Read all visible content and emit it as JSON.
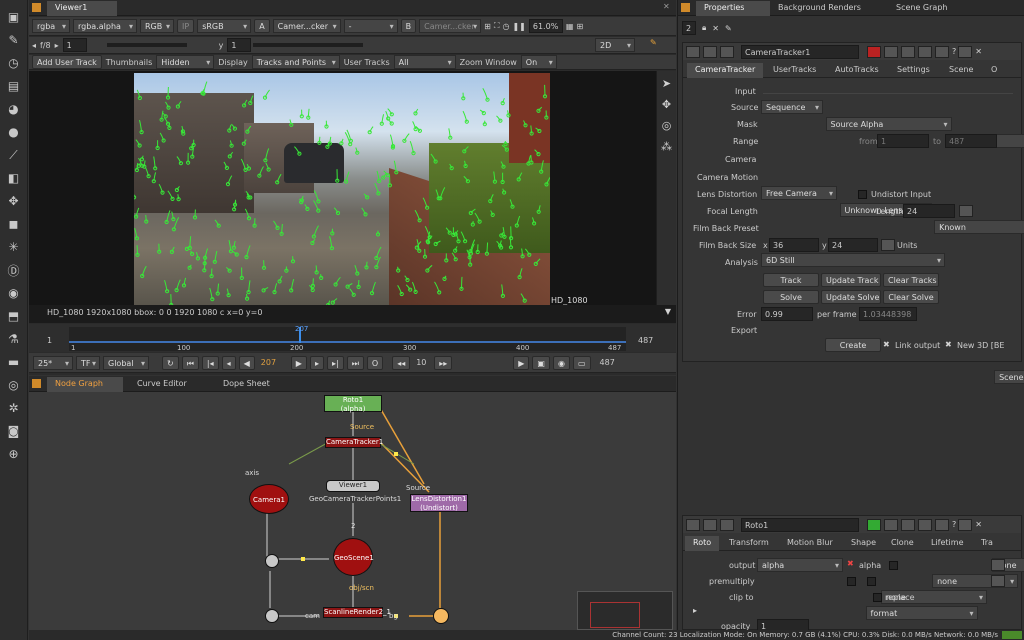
{
  "viewer": {
    "tab": "Viewer1",
    "channels": "rgba",
    "channel_alpha": "rgba.alpha",
    "colorspace": "RGB",
    "ip_label": "IP",
    "lut": "sRGB",
    "input_a_label": "A",
    "input_a": "Camer...cker",
    "input_a_sep": "-",
    "input_b_label": "B",
    "input_b": "Camer...cker",
    "zoom_pct": "61.0%",
    "fstop": "f/8",
    "gain": "1",
    "y_label": "y",
    "gamma": "1",
    "view_mode": "2D",
    "format_label": "HD_1080",
    "status_text": "HD_1080 1920x1080  bbox: 0 0 1920 1080 c  x=0 y=0"
  },
  "tracker_toolbar": {
    "add_user_track": "Add User Track",
    "thumbnails_label": "Thumbnails",
    "thumbnails_value": "Hidden",
    "display_label": "Display",
    "display_value": "Tracks and Points",
    "user_tracks_label": "User Tracks",
    "user_tracks_value": "All",
    "zoom_window_label": "Zoom Window",
    "zoom_window_value": "On"
  },
  "timeline": {
    "in_frame": "1",
    "out_frame": "487",
    "current_frame": "207",
    "ticks": [
      "1",
      "100",
      "200",
      "300",
      "400",
      "487"
    ],
    "fps": "25*",
    "tf": "TF",
    "scope": "Global",
    "step": "10",
    "end_frame": "487"
  },
  "node_graph": {
    "tabs": [
      "Node Graph",
      "Curve Editor",
      "Dope Sheet"
    ],
    "nodes": {
      "roto": "Roto1",
      "roto_sub": "(alpha)",
      "source": "Source",
      "camtracker": "CameraTracker1",
      "viewer": "Viewer1",
      "camera": "Camera1",
      "axis": "axis",
      "geopoints": "GeoCameraTrackerPoints1",
      "lens_source": "Source",
      "lens": "LensDistortion1",
      "lens_sub": "(Undistort)",
      "geoscene": "GeoScene1",
      "objscn": "obj/scn",
      "scanline": "ScanlineRender2_1",
      "cam": "cam",
      "bg": "bg",
      "num2": "2"
    }
  },
  "status_bar": "Channel Count: 23  Localization Mode: On  Memory: 0.7 GB (4.1%)  CPU: 0.3%  Disk: 0.0 MB/s  Network: 0.0 MB/s",
  "properties": {
    "tabs": [
      "Properties",
      "Background Renders",
      "Scene Graph"
    ],
    "count": "2",
    "camtracker_name": "CameraTracker1",
    "ct_tabs": [
      "CameraTracker",
      "UserTracks",
      "AutoTracks",
      "Settings",
      "Scene",
      "O"
    ],
    "input_section": "Input",
    "source_label": "Source",
    "source_value": "Sequence",
    "mask_label": "Mask",
    "mask_value": "Source Alpha",
    "range_label": "Range",
    "range_value": "Input",
    "from_label": "from",
    "from_value": "1",
    "to_label": "to",
    "to_value": "487",
    "camera_section": "Camera",
    "motion_label": "Camera Motion",
    "motion_value": "Free Camera",
    "lens_label": "Lens Distortion",
    "lens_value": "Unknown Lens",
    "undistort_label": "Undistort Input",
    "focal_label": "Focal Length",
    "focal_value": "Known",
    "length_label": "Length",
    "length_value": "24",
    "filmback_label": "Film Back Preset",
    "filmback_value": "6D Still",
    "filmsize_label": "Film Back Size",
    "x_label": "x",
    "film_x": "36",
    "y_label": "y",
    "film_y": "24",
    "units_label": "Units",
    "units_value": "mm",
    "analysis_section": "Analysis",
    "track_btn": "Track",
    "update_track_btn": "Update Track",
    "clear_tracks_btn": "Clear Tracks",
    "solve_btn": "Solve",
    "update_solve_btn": "Update Solve",
    "clear_solve_btn": "Clear Solve",
    "error_label": "Error",
    "error_value": "0.99",
    "per_frame_label": "per frame",
    "per_frame_value": "1.03448398",
    "export_section": "Export",
    "export_value": "Scene+",
    "create_btn": "Create",
    "link_output": "Link output",
    "new_3d": "New 3D [BE",
    "roto_name": "Roto1",
    "roto_tabs": [
      "Roto",
      "Transform",
      "Motion Blur",
      "Shape",
      "Clone",
      "Lifetime",
      "Tra"
    ],
    "output_label": "output",
    "output_value": "alpha",
    "alpha_label": "alpha",
    "none1": "none",
    "premult_label": "premultiply",
    "premult_value": "none",
    "none2": "none",
    "clip_label": "clip to",
    "clip_value": "format",
    "replace_label": "replace",
    "opacity_label": "opacity",
    "opacity_value": "1"
  }
}
